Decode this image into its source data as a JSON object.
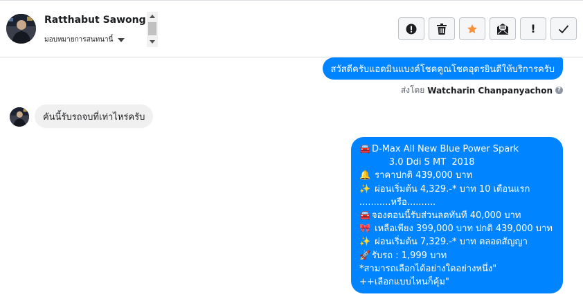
{
  "contact": {
    "name": "Ratthabut Sawongnam",
    "assign_label": "มอบหมายการสนทนานี้"
  },
  "toolbar": {
    "buttons": [
      {
        "name": "alert-circle-icon",
        "label": ""
      },
      {
        "name": "trash-icon",
        "label": ""
      },
      {
        "name": "star-icon",
        "label": ""
      },
      {
        "name": "mail-icon",
        "label": ""
      },
      {
        "name": "exclamation-icon",
        "label": "!"
      },
      {
        "name": "checkmark-icon",
        "label": ""
      }
    ],
    "star_color": "#f7923b"
  },
  "messages": {
    "greeting": "สวัสดีครับแอดมินแบงค์โชคคูณโชคอุดรยินดีให้บริการครับ",
    "sent_by_prefix": "ส่งโดย",
    "sent_by_name": "Watcharin Chanpanyachon",
    "customer_question": "คันนี้รับรถจบที่เท่าไหร่ครับ",
    "offer_lines": [
      {
        "emoji": "🚘",
        "text": "D-Max All New Blue Power Spark"
      },
      {
        "emoji": "",
        "text": "      3.0 Ddi S MT  2018"
      },
      {
        "emoji": "🔔",
        "text": " ราคาปกติ 439,000 บาท"
      },
      {
        "emoji": "✨",
        "text": " ผ่อนเริ่มต้น 4,329.-* บาท 10 เดือนแรก"
      },
      {
        "emoji": "",
        "text": "...........หรือ.........."
      },
      {
        "emoji": "🚘",
        "text": "จองตอนนี้รับส่วนลดทันที 40,000 บาท"
      },
      {
        "emoji": "🎀",
        "text": " เหลือเพียง 399,000 บาท ปกติ 439,000 บาท"
      },
      {
        "emoji": "✨",
        "text": " ผ่อนเริ่มต้น 7,329.-* บาท  ตลอดสัญญา"
      },
      {
        "emoji": "🚀",
        "text": "รับรถ : 1,999 บาท"
      },
      {
        "emoji": "",
        "text": "*สามารถเลือกได้อย่างใดอย่างหนึ่ง\""
      },
      {
        "emoji": "",
        "text": "++เลือกแบบไหนก็คุ้ม\""
      }
    ]
  },
  "colors": {
    "outgoing_bubble": "#0084ff",
    "incoming_bubble": "#f0f0f0"
  }
}
